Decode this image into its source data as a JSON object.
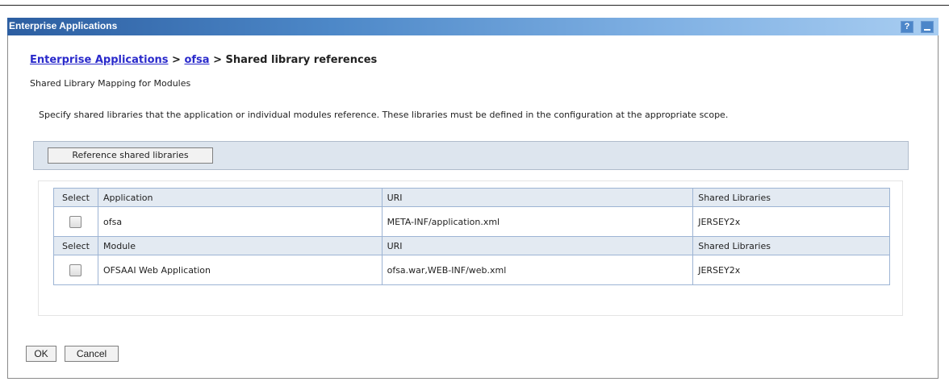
{
  "window": {
    "title": "Enterprise Applications",
    "help_glyph": "?"
  },
  "breadcrumb": {
    "root": "Enterprise Applications",
    "separator": ">",
    "app": "ofsa",
    "current": "Shared library references"
  },
  "subtitle": "Shared Library Mapping for Modules",
  "description": "Specify shared libraries that the application or individual modules reference. These libraries must be defined in the configuration at the appropriate scope.",
  "toolbar": {
    "reference_button": "Reference shared libraries"
  },
  "table": {
    "app_header": {
      "select": "Select",
      "name": "Application",
      "uri": "URI",
      "libs": "Shared Libraries"
    },
    "app_row": {
      "checked": false,
      "name": "ofsa",
      "uri": "META-INF/application.xml",
      "libs": "JERSEY2x"
    },
    "module_header": {
      "select": "Select",
      "name": "Module",
      "uri": "URI",
      "libs": "Shared Libraries"
    },
    "module_row": {
      "checked": false,
      "name": "OFSAAI Web Application",
      "uri": "ofsa.war,WEB-INF/web.xml",
      "libs": "JERSEY2x"
    }
  },
  "actions": {
    "ok": "OK",
    "cancel": "Cancel"
  },
  "colors": {
    "titlebar_start": "#2c5ea1",
    "titlebar_end": "#a8cdf1",
    "link": "#2a2acb",
    "header_bg": "#e3eaf2",
    "grid_border": "#9db4d4"
  },
  "icons": {
    "help": "help-icon",
    "minimize": "minimize-icon",
    "checkbox": "checkbox-icon"
  }
}
